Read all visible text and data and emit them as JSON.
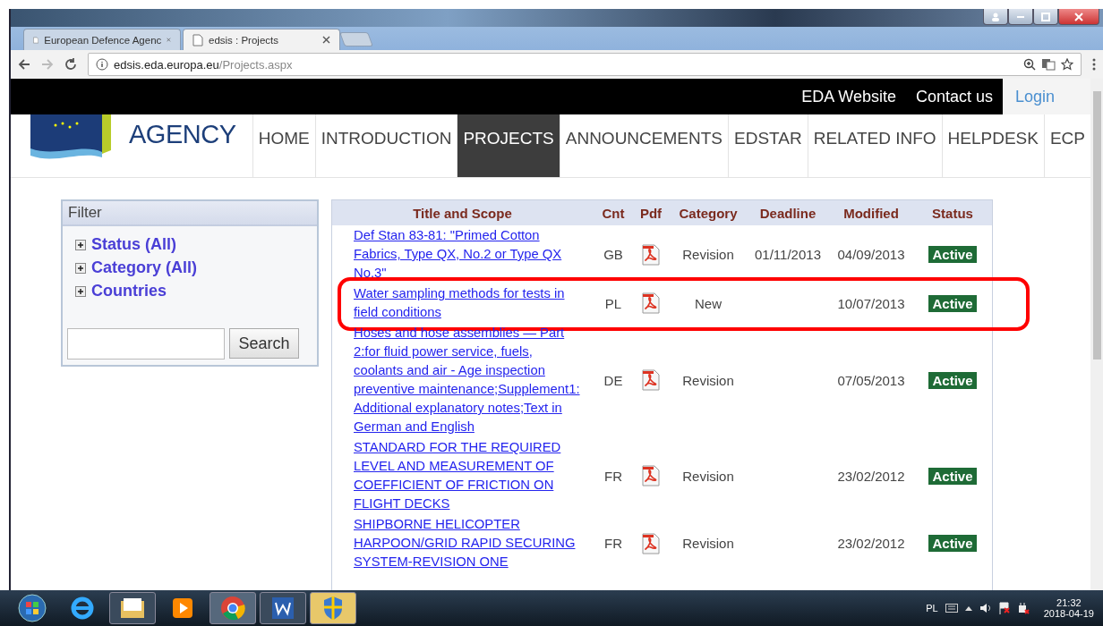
{
  "browser": {
    "tabs": [
      {
        "title": "European Defence Agenc",
        "selected": false
      },
      {
        "title": "edsis : Projects",
        "selected": true
      }
    ],
    "address": {
      "host": "edsis.eda.europa.eu",
      "path": "/Projects.aspx"
    }
  },
  "top_links": [
    {
      "label": "EDA Website",
      "kind": "link"
    },
    {
      "label": "Contact us",
      "kind": "link"
    },
    {
      "label": "Login",
      "kind": "login"
    }
  ],
  "logo": {
    "text": "AGENCY"
  },
  "nav": [
    {
      "label": "HOME",
      "selected": false
    },
    {
      "label": "INTRODUCTION",
      "selected": false
    },
    {
      "label": "PROJECTS",
      "selected": true
    },
    {
      "label": "ANNOUNCEMENTS",
      "selected": false
    },
    {
      "label": "EDSTAR",
      "selected": false
    },
    {
      "label": "RELATED INFO",
      "selected": false
    },
    {
      "label": "HELPDESK",
      "selected": false
    },
    {
      "label": "ECP",
      "selected": false
    }
  ],
  "filter": {
    "title": "Filter",
    "items": [
      {
        "label": "Status (All)",
        "expanded": false
      },
      {
        "label": "Category (All)",
        "expanded": false
      },
      {
        "label": "Countries",
        "expanded": false
      }
    ],
    "search_button": "Search"
  },
  "table": {
    "columns": [
      "Title and Scope",
      "Cnt",
      "Pdf",
      "Category",
      "Deadline",
      "Modified",
      "Status"
    ],
    "rows": [
      {
        "title": "Def Stan 83-81: \"Primed Cotton Fabrics, Type QX, No.2 or Type QX No.3\"",
        "country": "GB",
        "category": "Revision",
        "deadline": "01/11/2013",
        "modified": "04/09/2013",
        "status": "Active",
        "highlighted": false
      },
      {
        "title": "Water sampling methods for tests in field conditions",
        "country": "PL",
        "category": "New",
        "deadline": "",
        "modified": "10/07/2013",
        "status": "Active",
        "highlighted": true
      },
      {
        "title": "Hoses and hose assemblies — Part 2:for fluid power service, fuels, coolants and air - Age inspection preventive maintenance;Supplement1: Additional explanatory notes;Text in German and English",
        "country": "DE",
        "category": "Revision",
        "deadline": "",
        "modified": "07/05/2013",
        "status": "Active",
        "highlighted": false
      },
      {
        "title": "STANDARD FOR THE REQUIRED LEVEL AND MEASUREMENT OF COEFFICIENT OF FRICTION ON FLIGHT DECKS",
        "country": "FR",
        "category": "Revision",
        "deadline": "",
        "modified": "23/02/2012",
        "status": "Active",
        "highlighted": false
      },
      {
        "title": "SHIPBORNE HELICOPTER HARPOON/GRID RAPID SECURING SYSTEM-REVISION ONE",
        "country": "FR",
        "category": "Revision",
        "deadline": "",
        "modified": "23/02/2012",
        "status": "Active",
        "highlighted": false
      }
    ]
  },
  "tray": {
    "language": "PL",
    "time": "21:32",
    "date": "2018-04-19"
  }
}
